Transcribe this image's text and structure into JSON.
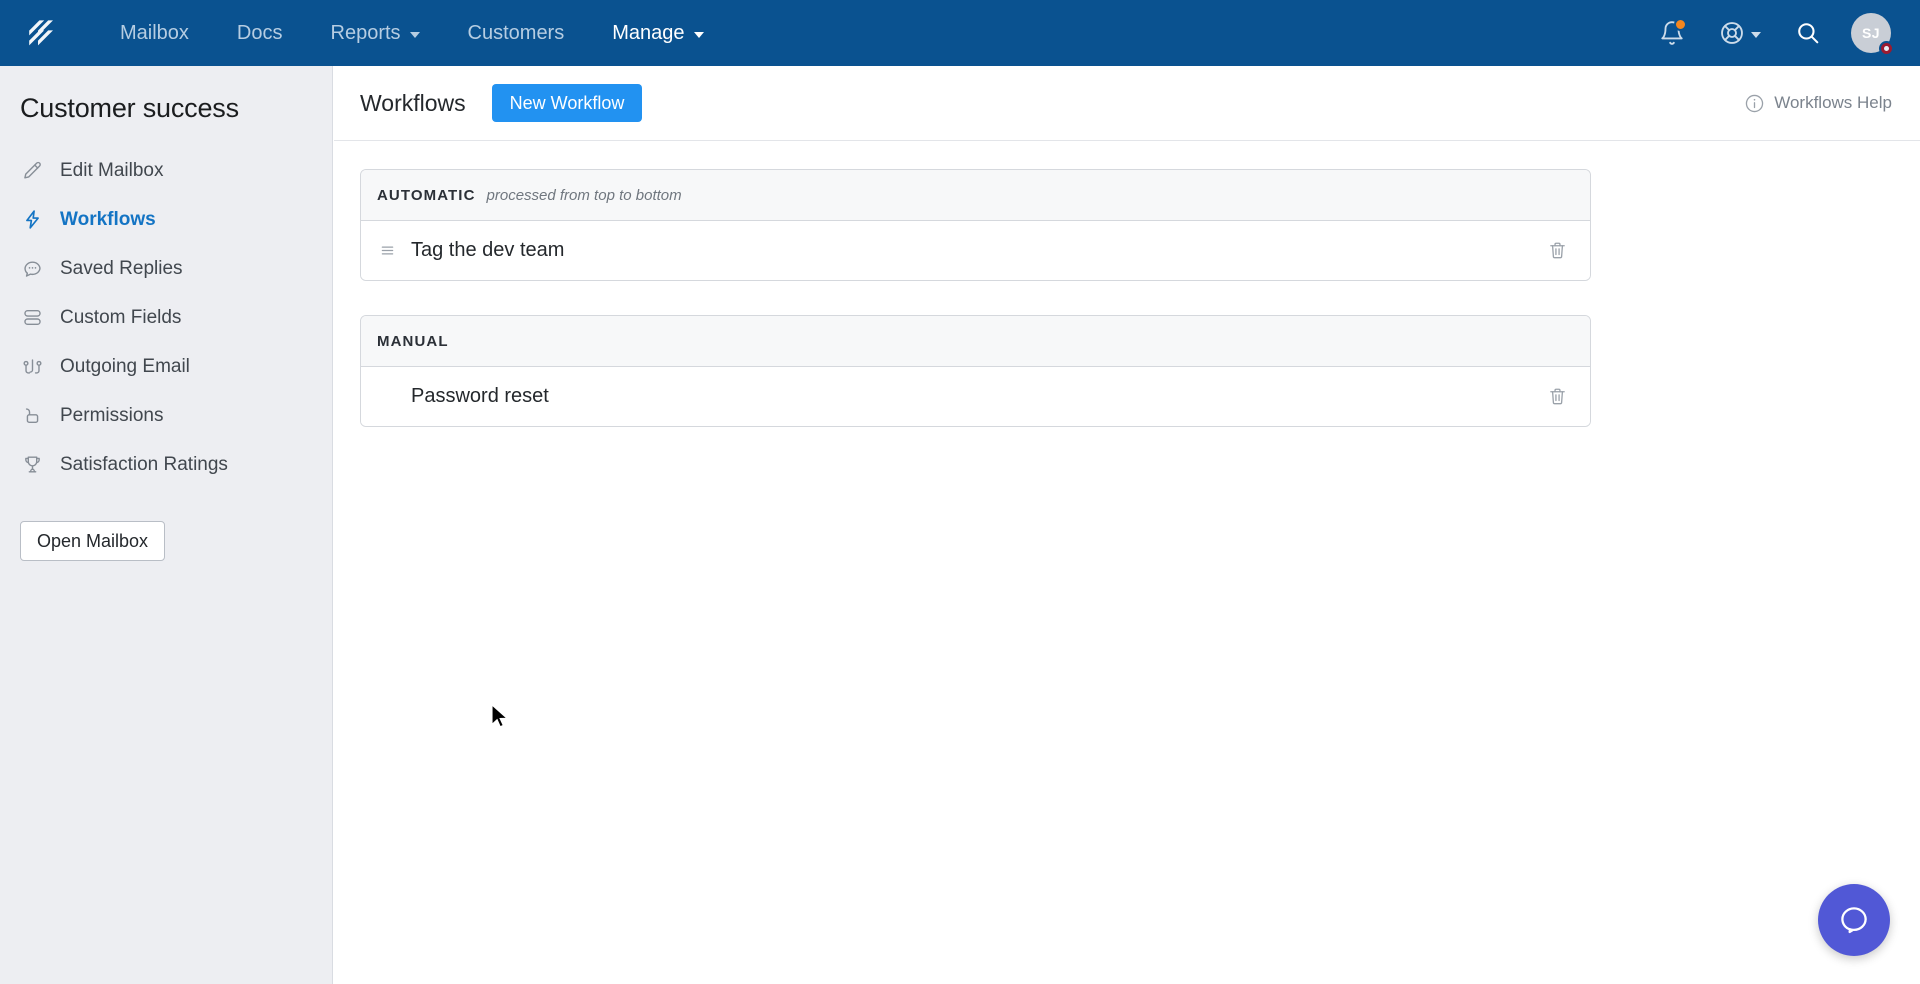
{
  "topnav": {
    "logo_name": "helpscout-logo",
    "links": [
      {
        "label": "Mailbox",
        "active": false,
        "caret": false
      },
      {
        "label": "Docs",
        "active": false,
        "caret": false
      },
      {
        "label": "Reports",
        "active": false,
        "caret": true
      },
      {
        "label": "Customers",
        "active": false,
        "caret": false
      },
      {
        "label": "Manage",
        "active": true,
        "caret": true
      }
    ],
    "icons": {
      "notifications": "bell-icon",
      "notifications_has_badge": true,
      "help": "lifesaver-icon",
      "search": "search-icon"
    },
    "avatar": {
      "initials": "SJ",
      "has_status_badge": true
    },
    "colors": {
      "background": "#0a5290",
      "link": "#b6cde2",
      "active_link": "#ffffff",
      "badge": "#f5871f",
      "avatar_badge": "#9b1b30"
    }
  },
  "sidebar": {
    "title": "Customer success",
    "items": [
      {
        "label": "Edit Mailbox",
        "icon": "pencil-icon",
        "active": false
      },
      {
        "label": "Workflows",
        "icon": "bolt-icon",
        "active": true
      },
      {
        "label": "Saved Replies",
        "icon": "chat-bubble-icon",
        "active": false
      },
      {
        "label": "Custom Fields",
        "icon": "stacked-rows-icon",
        "active": false
      },
      {
        "label": "Outgoing Email",
        "icon": "outgoing-email-icon",
        "active": false
      },
      {
        "label": "Permissions",
        "icon": "lock-icon",
        "active": false
      },
      {
        "label": "Satisfaction Ratings",
        "icon": "trophy-icon",
        "active": false
      }
    ],
    "open_mailbox_label": "Open Mailbox",
    "colors": {
      "background": "#edeef2",
      "active_text": "#1474c4",
      "text": "#41474e"
    }
  },
  "main": {
    "page_title": "Workflows",
    "new_workflow_label": "New Workflow",
    "help_link_label": "Workflows Help",
    "help_link_icon": "info-circle-icon",
    "accent_color": "#2292f1",
    "groups": [
      {
        "kind": "AUTOMATIC",
        "note": "processed from top to bottom",
        "draggable": true,
        "rows": [
          {
            "name": "Tag the dev team"
          }
        ]
      },
      {
        "kind": "MANUAL",
        "note": "",
        "draggable": false,
        "rows": [
          {
            "name": "Password reset"
          }
        ]
      }
    ]
  },
  "beacon": {
    "icon": "chat-bubble-icon",
    "color": "#5158d6"
  }
}
